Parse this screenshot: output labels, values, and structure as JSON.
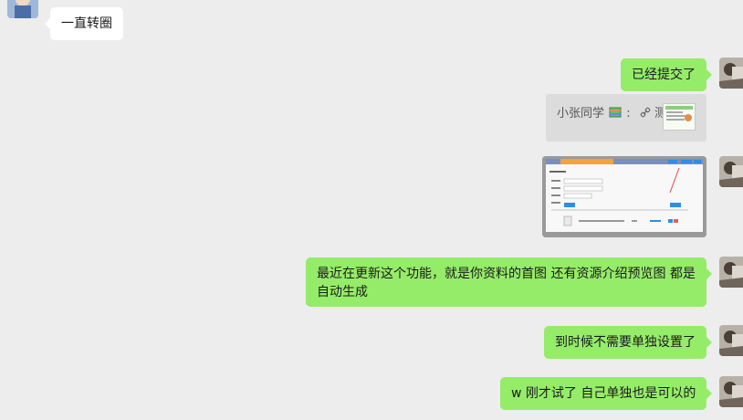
{
  "messages": {
    "m1": "一直转圈",
    "m2": "已经提交了",
    "m3_card": {
      "title": "小张同学",
      "separator": ":",
      "link_text": "测试"
    },
    "m5": "最近在更新这个功能，就是你资料的首图 还有资源介绍预览图 都是自动生成",
    "m6": "到时候不需要单独设置了",
    "m7": "w 刚才试了 自己单独也是可以的"
  },
  "icons": {
    "link_icon": "link-icon",
    "emoji_icon": "book-emoji-icon"
  },
  "colors": {
    "background": "#ededed",
    "bubble_right": "#95ec69",
    "bubble_left": "#ffffff",
    "card_bg": "#dcdcdc"
  }
}
